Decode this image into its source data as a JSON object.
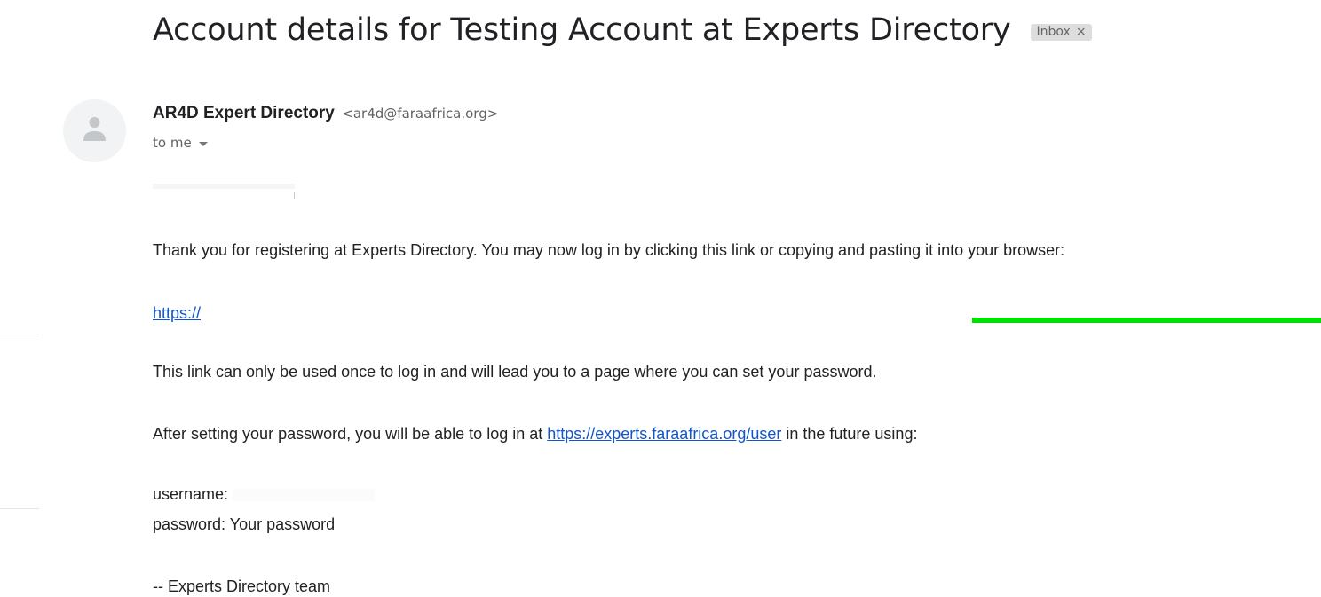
{
  "email": {
    "subject": "Account details for Testing Account at Experts Directory",
    "label": "Inbox",
    "label_close": "×",
    "sender_name": "AR4D Expert Directory",
    "sender_email": "<ar4d@faraafrica.org>",
    "recipient": "to me",
    "body": {
      "intro": "Thank you for registering at Experts Directory. You may now log in by clicking this link or copying and pasting it into your browser:",
      "login_link": "https://",
      "once_note": "This link can only be used once to log in and will lead you to a page where you can set your password.",
      "after_prefix": "After setting your password, you will be able to log in at ",
      "user_link": "https://experts.faraafrica.org/user",
      "after_suffix": " in the future using:",
      "username_label": "username:",
      "password_line": "password: Your password",
      "signature": "--  Experts Directory team"
    }
  },
  "colors": {
    "link": "#1155cc",
    "highlight": "#00e000",
    "label_chip": "#dddddd"
  },
  "icons": {
    "avatar": "person-icon",
    "recipient_details": "caret-down-icon",
    "label_remove": "close-icon"
  }
}
